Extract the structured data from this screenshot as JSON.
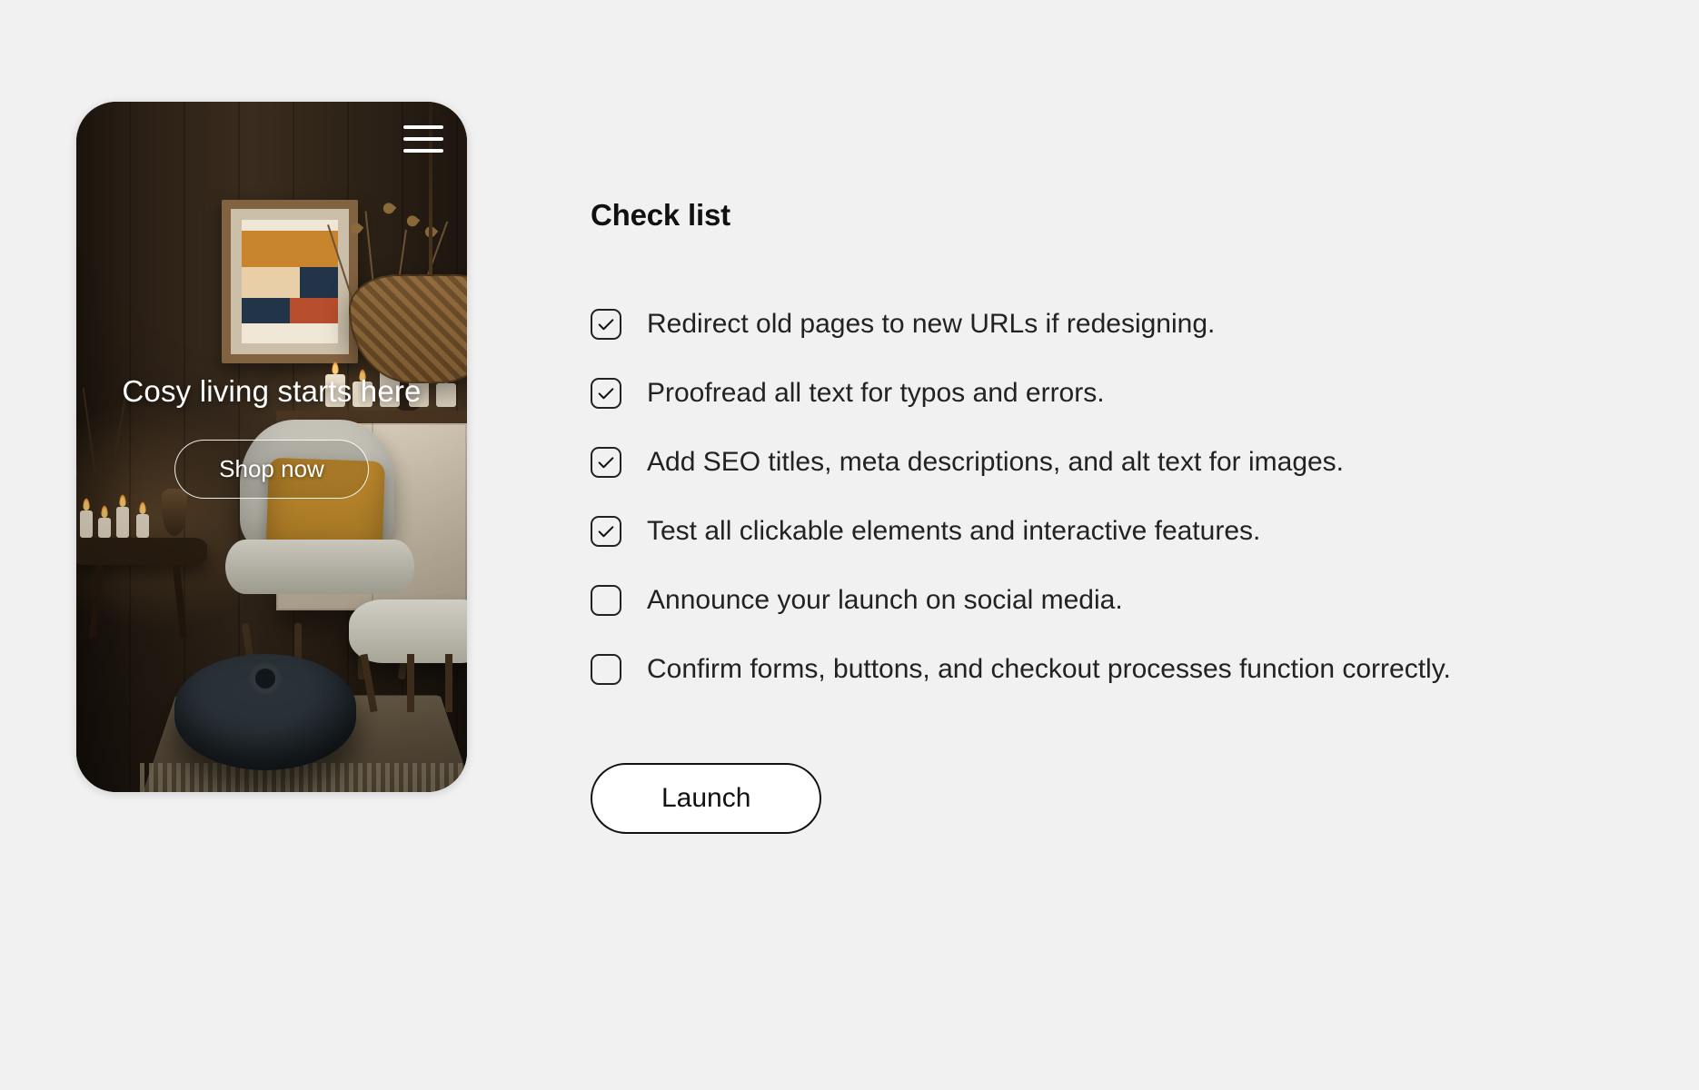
{
  "preview": {
    "hero_title": "Cosy living starts here",
    "cta_label": "Shop now"
  },
  "panel": {
    "heading": "Check list",
    "launch_label": "Launch",
    "items": [
      {
        "checked": true,
        "label": "Redirect old pages to new URLs if redesigning."
      },
      {
        "checked": true,
        "label": "Proofread all text for typos and errors."
      },
      {
        "checked": true,
        "label": "Add SEO titles, meta descriptions, and alt text for images."
      },
      {
        "checked": true,
        "label": "Test all clickable elements and interactive features."
      },
      {
        "checked": false,
        "label": "Announce your launch on social media."
      },
      {
        "checked": false,
        "label": "Confirm forms, buttons, and checkout processes function correctly."
      }
    ]
  }
}
